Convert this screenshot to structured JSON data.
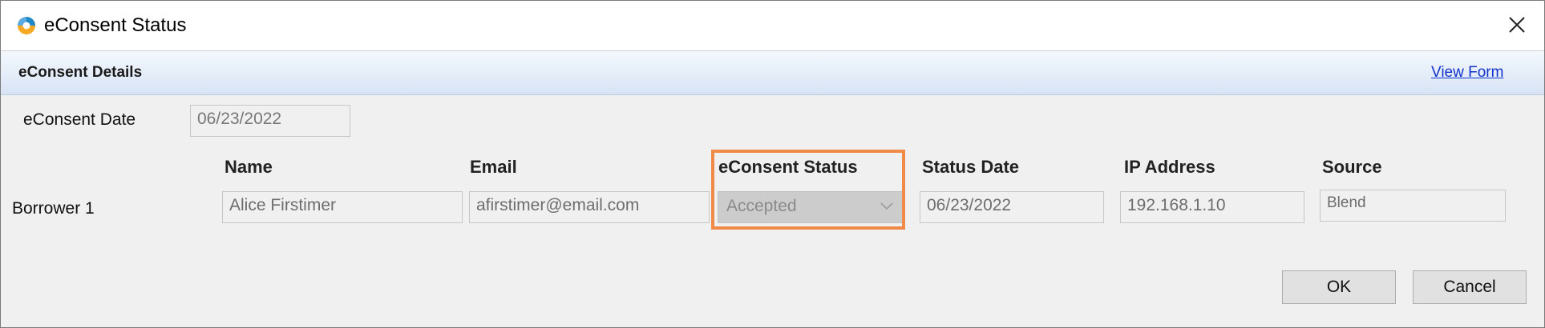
{
  "window": {
    "title": "eConsent Status",
    "icon": "app-logo-icon",
    "close_icon": "close-icon"
  },
  "section": {
    "title": "eConsent Details",
    "view_form_link": "View Form"
  },
  "econsent_date": {
    "label": "eConsent Date",
    "value": "06/23/2022"
  },
  "columns": {
    "name": "Name",
    "email": "Email",
    "status": "eConsent Status",
    "status_date": "Status Date",
    "ip_address": "IP Address",
    "source": "Source"
  },
  "borrowers": [
    {
      "label": "Borrower 1",
      "name": "Alice Firstimer",
      "email": "afirstimer@email.com",
      "status": "Accepted",
      "status_date": "06/23/2022",
      "ip_address": "192.168.1.10",
      "source": "Blend"
    }
  ],
  "buttons": {
    "ok": "OK",
    "cancel": "Cancel"
  },
  "colors": {
    "highlight": "#f08a48",
    "link": "#1133cc",
    "header_gradient_top": "#f4f8fd",
    "header_gradient_bottom": "#d7e3f4"
  }
}
